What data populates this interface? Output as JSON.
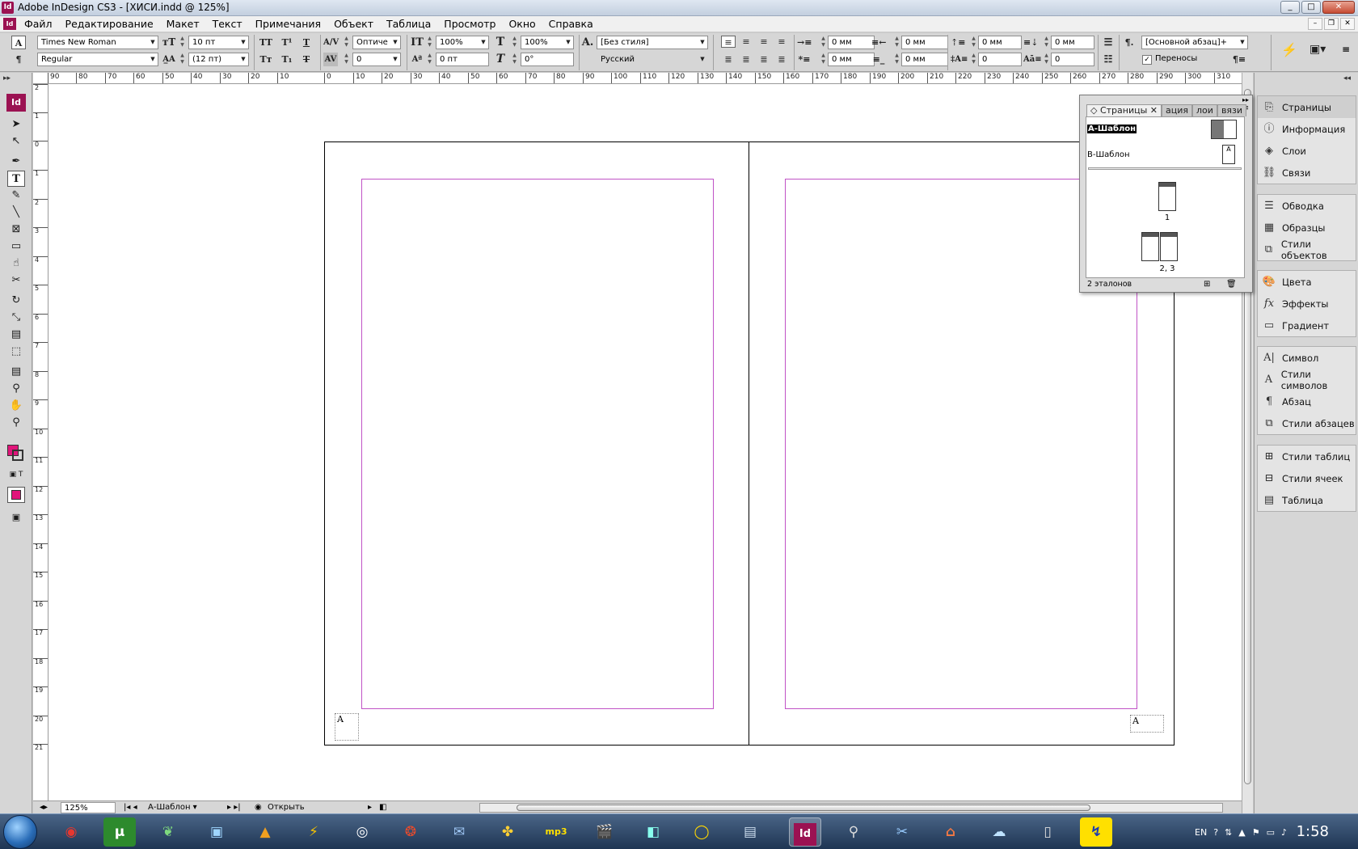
{
  "window": {
    "title": "Adobe InDesign CS3 - [ХИСИ.indd @ 125%]",
    "app_icon": "Id",
    "buttons": {
      "minimize": "_",
      "maximize": "□",
      "close": "✕"
    }
  },
  "menu": {
    "items": [
      "Файл",
      "Редактирование",
      "Макет",
      "Текст",
      "Примечания",
      "Объект",
      "Таблица",
      "Просмотр",
      "Окно",
      "Справка"
    ],
    "mdi": {
      "minimize": "–",
      "restore": "❐",
      "close": "✕"
    }
  },
  "control": {
    "font_family": "Times New Roman",
    "font_style": "Regular",
    "font_size": "10 пт",
    "leading": "(12 пт)",
    "kerning": "Оптиче",
    "tracking": "0",
    "vscale": "100%",
    "hscale": "100%",
    "baseline": "0 пт",
    "skew": "0°",
    "char_style": "[Без стиля]",
    "language": "Русский",
    "left_indent": "0 мм",
    "right_indent": "0 мм",
    "first_indent": "0 мм",
    "last_indent": "0 мм",
    "space_before": "0 мм",
    "space_after": "0 мм",
    "dropcap_lines": "0",
    "dropcap_chars": "0",
    "para_style": "[Основной абзац]+",
    "hyphenation_label": "Переносы",
    "hyphenation_checked": true
  },
  "ruler": {
    "h_ticks": [
      "90",
      "80",
      "70",
      "60",
      "50",
      "40",
      "30",
      "20",
      "10",
      "0",
      "10",
      "20",
      "30",
      "40",
      "50",
      "60",
      "70",
      "80",
      "90",
      "100",
      "110",
      "120",
      "130",
      "140",
      "150",
      "160",
      "170",
      "180",
      "190",
      "200",
      "210",
      "220",
      "230",
      "240",
      "250",
      "260",
      "270",
      "280",
      "290",
      "300",
      "310"
    ],
    "v_ticks": [
      "2",
      "1",
      "0",
      "1",
      "2",
      "3",
      "4",
      "5",
      "6",
      "7",
      "8",
      "9",
      "10",
      "11",
      "12",
      "13",
      "14",
      "15",
      "16",
      "17",
      "18",
      "19",
      "20",
      "21"
    ]
  },
  "document": {
    "left_master_marker": "A",
    "right_master_marker": "A"
  },
  "pages_panel": {
    "tabs": [
      "Страницы",
      "ация",
      "лои",
      "вязи"
    ],
    "masters": [
      {
        "name": "А-Шаблон",
        "selected": true
      },
      {
        "name": "В-Шаблон",
        "selected": false
      }
    ],
    "thumb_master_letter": "А",
    "page_labels": [
      "1",
      "2, 3"
    ],
    "footer": "2 эталонов"
  },
  "dock": {
    "groups": [
      [
        {
          "label": "Страницы",
          "icon": "pages-icon",
          "active": true
        },
        {
          "label": "Информация",
          "icon": "info-icon"
        },
        {
          "label": "Слои",
          "icon": "layers-icon"
        },
        {
          "label": "Связи",
          "icon": "links-icon"
        }
      ],
      [
        {
          "label": "Обводка",
          "icon": "stroke-icon"
        },
        {
          "label": "Образцы",
          "icon": "swatches-icon"
        },
        {
          "label": "Стили объектов",
          "icon": "object-styles-icon"
        }
      ],
      [
        {
          "label": "Цвета",
          "icon": "color-icon"
        },
        {
          "label": "Эффекты",
          "icon": "effects-icon"
        },
        {
          "label": "Градиент",
          "icon": "gradient-icon"
        }
      ],
      [
        {
          "label": "Символ",
          "icon": "character-icon"
        },
        {
          "label": "Стили символов",
          "icon": "character-styles-icon"
        },
        {
          "label": "Абзац",
          "icon": "paragraph-icon"
        },
        {
          "label": "Стили абзацев",
          "icon": "paragraph-styles-icon"
        }
      ],
      [
        {
          "label": "Стили таблиц",
          "icon": "table-styles-icon"
        },
        {
          "label": "Стили ячеек",
          "icon": "cell-styles-icon"
        },
        {
          "label": "Таблица",
          "icon": "table-icon"
        }
      ]
    ]
  },
  "status": {
    "zoom": "125%",
    "page": "А-Шаблон",
    "open": "Открыть"
  },
  "taskbar": {
    "lang": "EN",
    "clock": "1:58",
    "indesign_label": "Id"
  },
  "colors": {
    "indesign_brand": "#9b1252",
    "margin_guide": "#c052c6",
    "fill_swatch": "#e0157a"
  }
}
